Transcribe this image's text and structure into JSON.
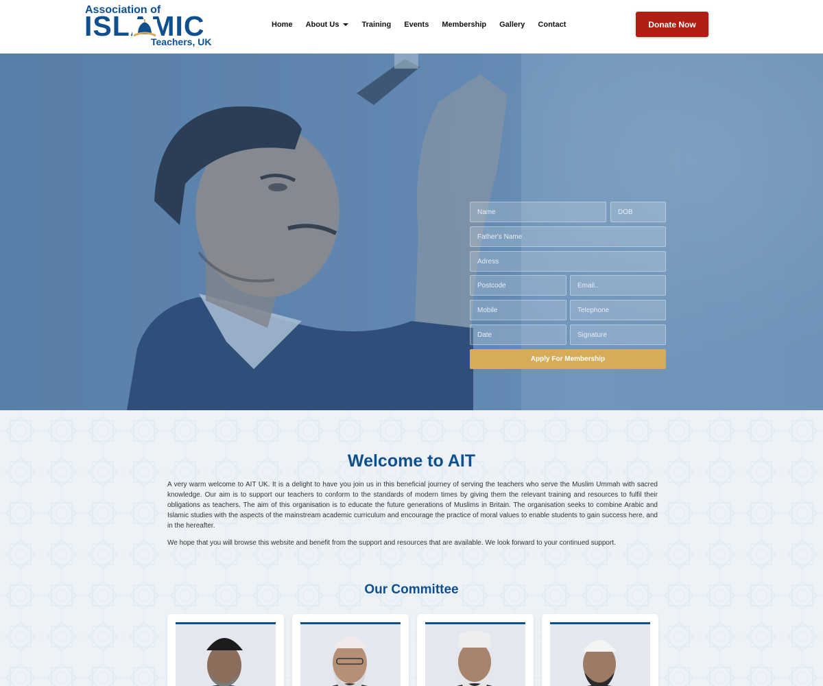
{
  "header": {
    "logo": {
      "line1": "Association of",
      "line2": "ISLAMIC",
      "line3": "Teachers, UK"
    },
    "nav": [
      {
        "label": "Home"
      },
      {
        "label": "About Us",
        "has_dropdown": true
      },
      {
        "label": "Training"
      },
      {
        "label": "Events"
      },
      {
        "label": "Membership"
      },
      {
        "label": "Gallery"
      },
      {
        "label": "Contact"
      }
    ],
    "donate_label": "Donate Now"
  },
  "form": {
    "name": "Name",
    "dob": "DOB",
    "father_name": "Father's Name",
    "address": "Adress",
    "postcode": "Postcode",
    "email": "Email..",
    "mobile": "Mobile",
    "telephone": "Telephone",
    "date": "Date",
    "signature": "Signature",
    "submit_label": "Apply For Membership"
  },
  "welcome": {
    "title": "Welcome to AIT",
    "paragraph1": "A very warm welcome to AIT UK. It is a delight to have you join us in this beneficial journey of serving the teachers who serve the Muslim Ummah with sacred knowledge. Our aim is to support our teachers to conform to the standards of  modern times by giving them the relevant training and resources to fulfil their obligations as teachers. The aim of this organisation is to educate the future generations of Muslims in Britain. The organisation seeks to combine Arabic and Islamic studies with the aspects of the mainstream academic curriculum and encourage the practice of moral values to enable students to gain success here, and in the hereafter.",
    "paragraph2": "We hope that you will browse this website and benefit from the support and resources that are available. We look forward to your continued support."
  },
  "committee": {
    "title": "Our Committee",
    "members": [
      {
        "cap_color": "#1c1c1c",
        "beard_color": "#7a7a7a"
      },
      {
        "cap_color": "#f1e9ea",
        "beard_color": "#d9d9d9"
      },
      {
        "cap_color": "#eeeeee",
        "beard_color": "#e6e6e6"
      },
      {
        "cap_color": "#f4f4f4",
        "beard_color": "#2b2b2b"
      }
    ]
  },
  "colors": {
    "brand_blue": "#0d4f8f",
    "donate_red": "#b01e14",
    "apply_gold": "#d6ac58"
  }
}
